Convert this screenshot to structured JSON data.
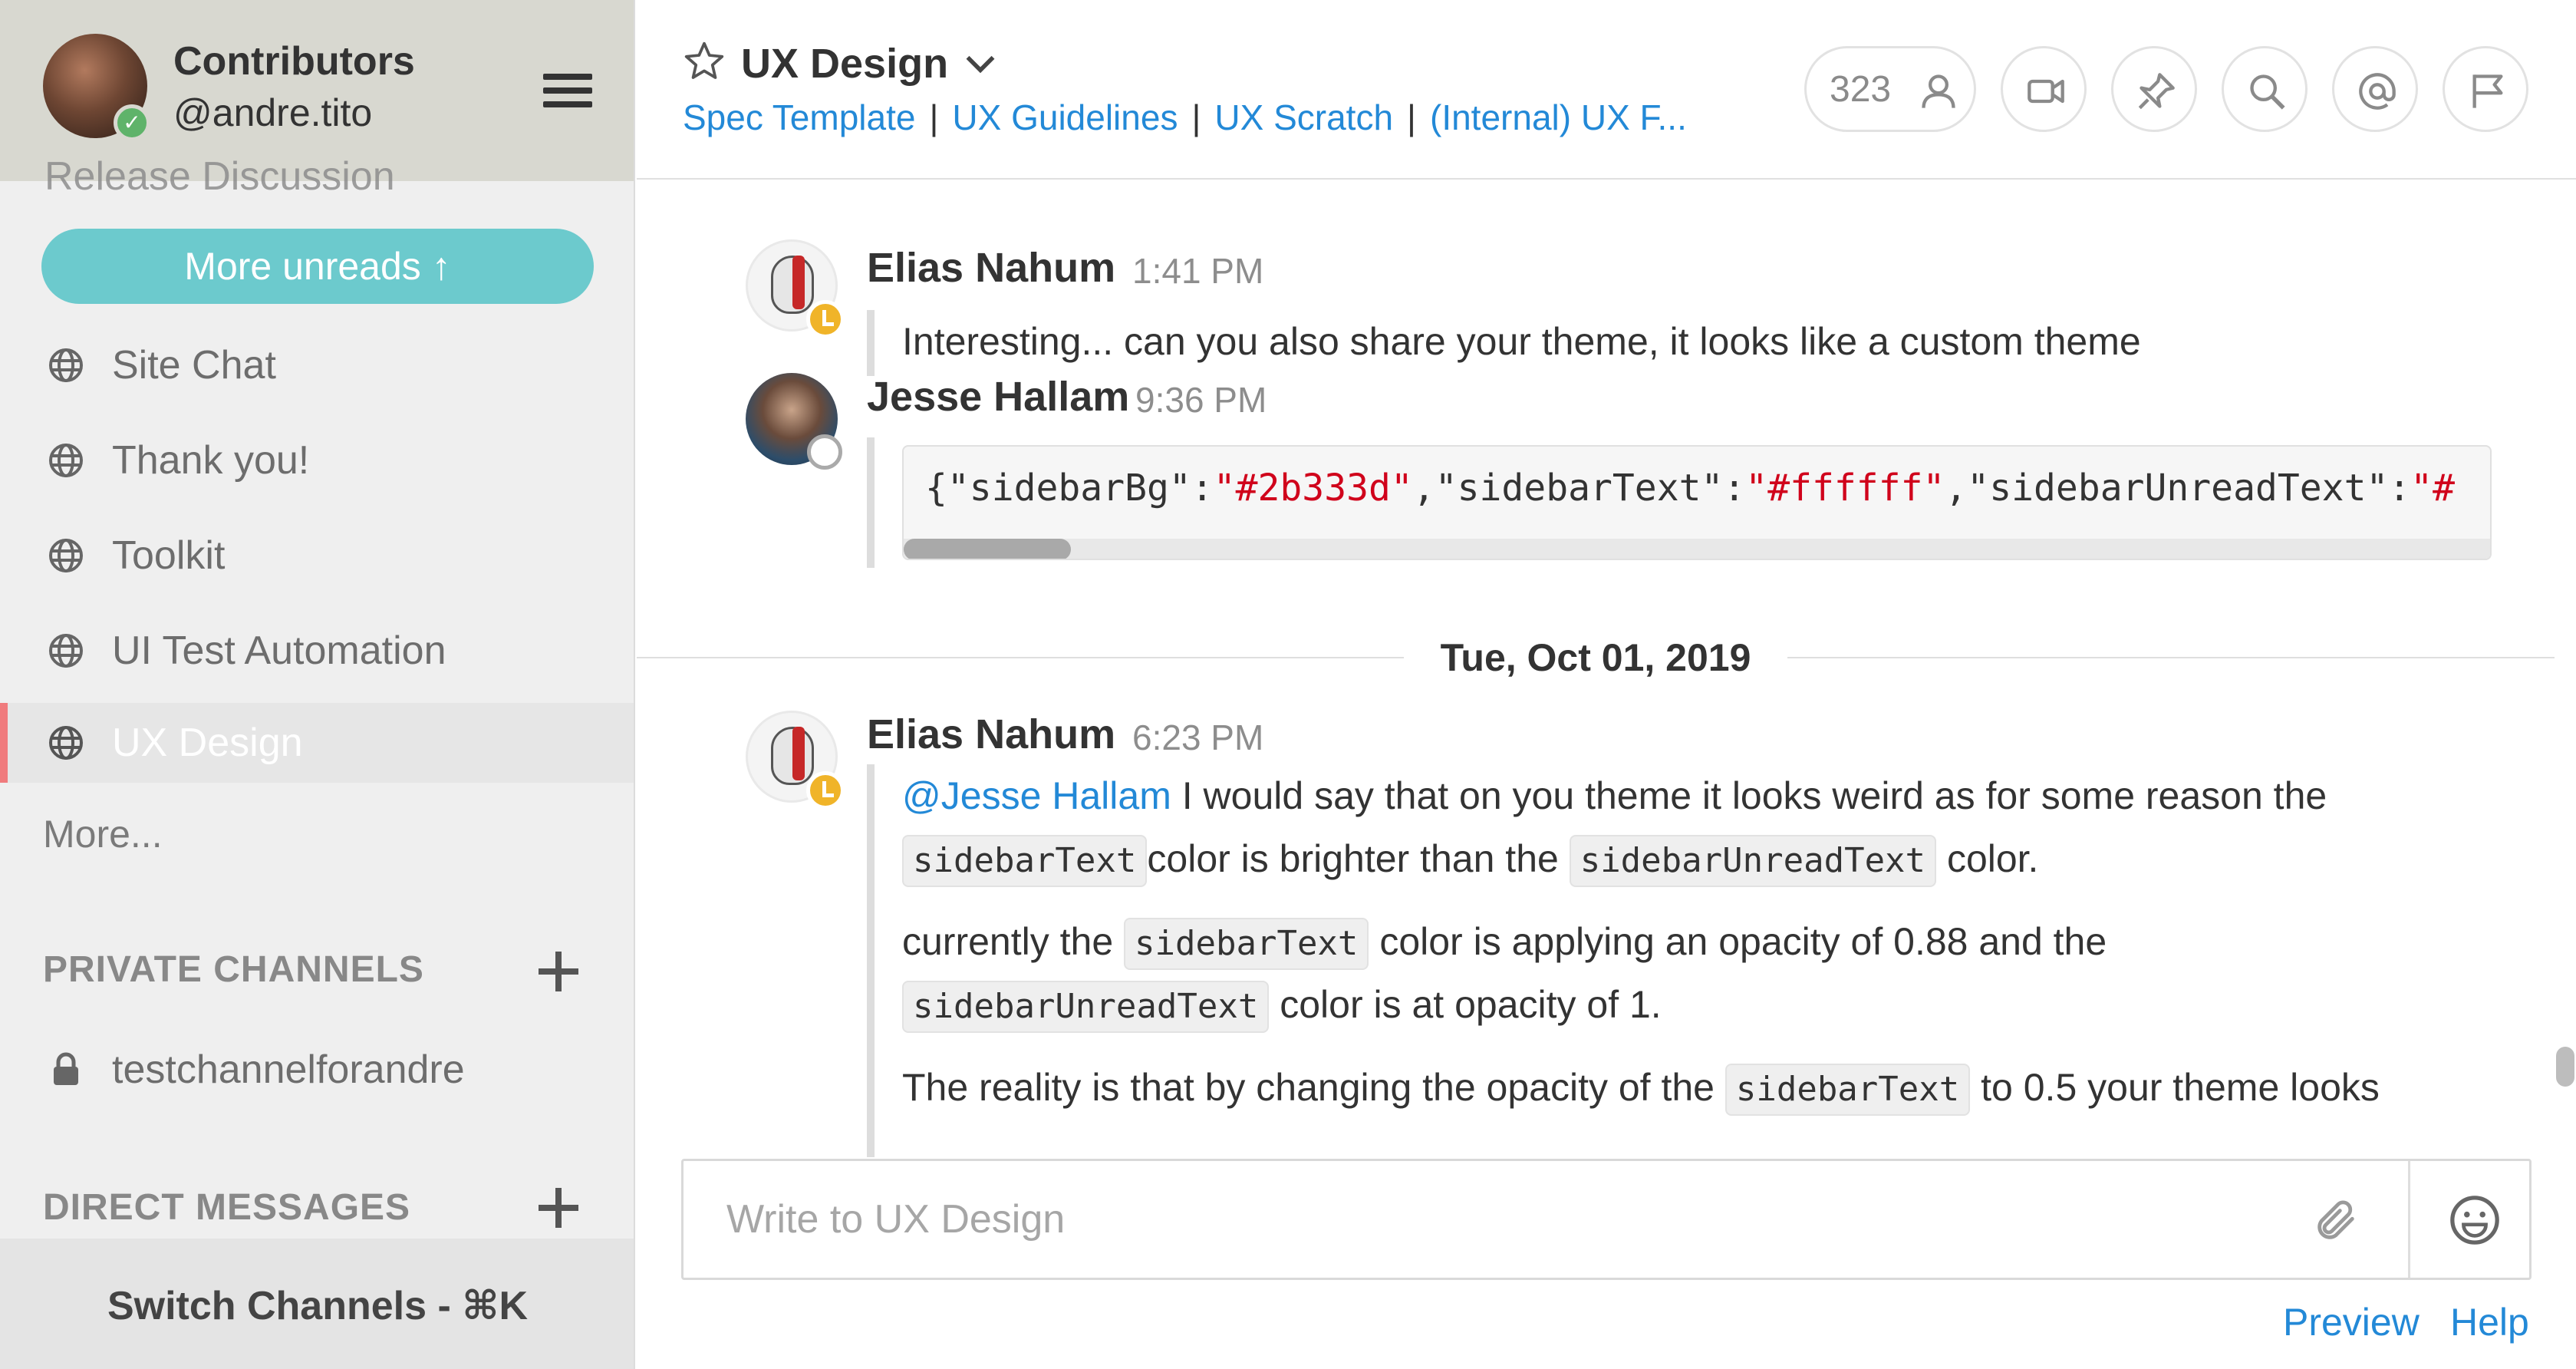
{
  "team": {
    "name": "Contributors",
    "username": "@andre.tito"
  },
  "sidebar": {
    "cut_off_item": "Release Discussion",
    "more_unreads": "More unreads",
    "public_channels": [
      {
        "label": "Site Chat"
      },
      {
        "label": "Thank you!"
      },
      {
        "label": "Toolkit"
      },
      {
        "label": "UI Test Automation"
      },
      {
        "label": "UX Design",
        "active": true
      }
    ],
    "more_link": "More...",
    "private_title": "PRIVATE CHANNELS",
    "private_channels": [
      {
        "label": "testchannelforandre"
      }
    ],
    "dm_title": "DIRECT MESSAGES",
    "switch_channels": "Switch Channels - ⌘K"
  },
  "header": {
    "channel_title": "UX Design",
    "links": [
      "Spec Template",
      "UX Guidelines",
      "UX Scratch",
      "(Internal) UX F..."
    ],
    "link_separator": "|",
    "member_count": "323",
    "buttons": [
      "video-call-icon",
      "pin-icon",
      "search-icon",
      "at-mention-icon",
      "flag-icon"
    ]
  },
  "messages": {
    "post1": {
      "author": "Elias Nahum",
      "time": "1:41 PM",
      "text": "Interesting... can you also share your theme, it looks like a custom theme"
    },
    "post2": {
      "author": "Jesse Hallam",
      "time": "9:36 PM",
      "code_tokens": [
        {
          "t": "{",
          "c": "tok-key"
        },
        {
          "t": "\"sidebarBg\"",
          "c": "tok-key"
        },
        {
          "t": ":",
          "c": "tok-key"
        },
        {
          "t": "\"#2b333d\"",
          "c": "tok-str"
        },
        {
          "t": ",",
          "c": "tok-key"
        },
        {
          "t": "\"sidebarText\"",
          "c": "tok-key"
        },
        {
          "t": ":",
          "c": "tok-key"
        },
        {
          "t": "\"#ffffff\"",
          "c": "tok-str"
        },
        {
          "t": ",",
          "c": "tok-key"
        },
        {
          "t": "\"sidebarUnreadText\"",
          "c": "tok-key"
        },
        {
          "t": ":",
          "c": "tok-key"
        },
        {
          "t": "\"#",
          "c": "tok-str"
        }
      ]
    },
    "date_separator": "Tue, Oct 01, 2019",
    "post3": {
      "author": "Elias Nahum",
      "time": "6:23 PM",
      "mention": "@Jesse Hallam",
      "p1_a": " I would say that on you theme it looks weird as for some reason the",
      "code_sidebarText": "sidebarText",
      "p1_b": "color is brighter than the ",
      "code_sidebarUnreadText": "sidebarUnreadText",
      "p1_c": " color.",
      "p2_a": "currently the ",
      "p2_b": " color is applying an opacity of 0.88 and the",
      "p2_c": " color is at opacity of 1.",
      "p3_a": "The reality is that by changing the opacity of the ",
      "p3_b": " to 0.5 your theme looks"
    }
  },
  "composer": {
    "placeholder": "Write to UX Design",
    "preview": "Preview",
    "help": "Help"
  },
  "colors": {
    "accent_link": "#2389d7",
    "more_unreads_bg": "#6ccacd",
    "active_channel_marker": "#f07b7d",
    "code_string": "#d0021b",
    "away_status": "#f0b429",
    "online_status": "#5fb36a"
  }
}
